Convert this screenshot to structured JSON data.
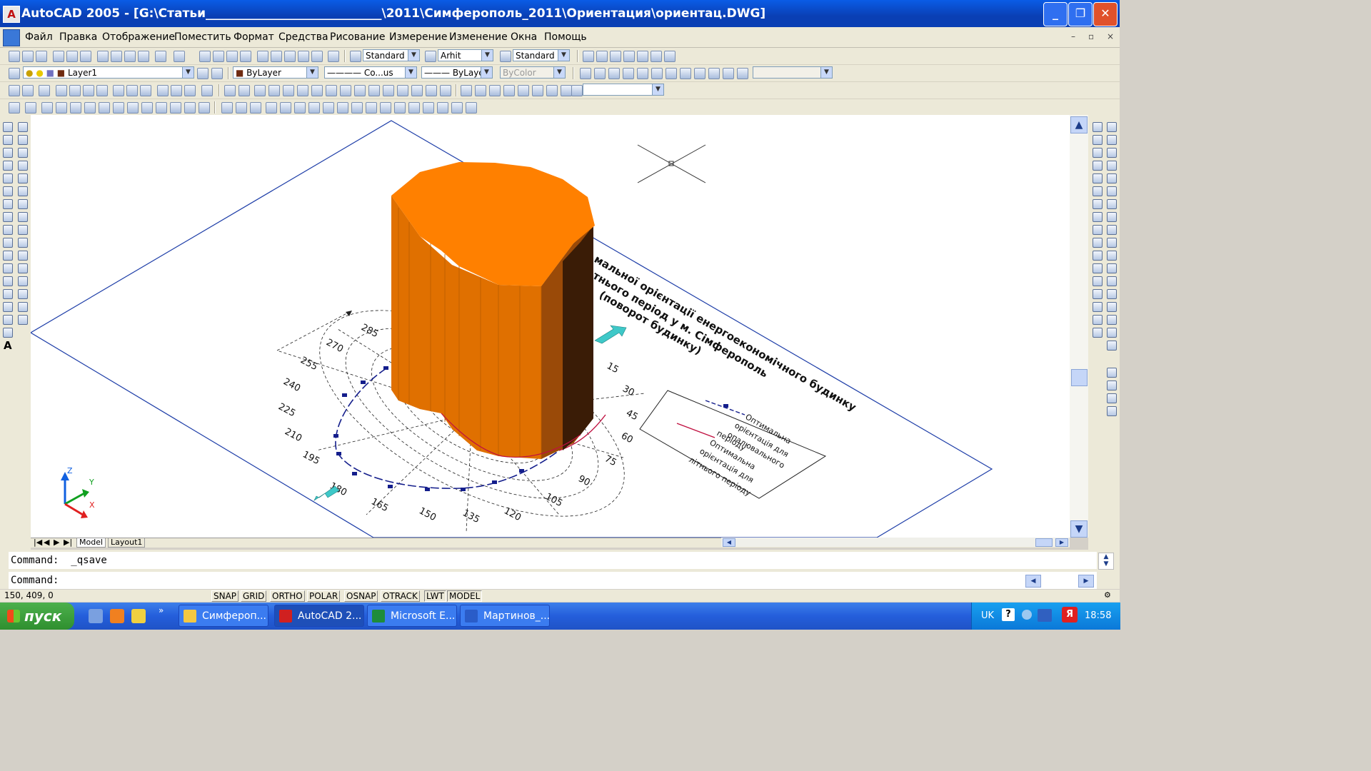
{
  "window": {
    "app_icon": "autocad-app-icon",
    "title": "AutoCAD 2005 - [G:\\Статьи_____________________________\\2011\\Симферополь_2011\\Ориентация\\ориентац.DWG]",
    "minimize_glyph": "_",
    "restore_glyph": "❐",
    "close_glyph": "✕"
  },
  "menu": [
    "Файл",
    "Правка",
    "Отображение",
    "Поместить",
    "Формат",
    "Средства",
    "Рисование",
    "Измерение",
    "Изменение",
    "Окна",
    "Помощь"
  ],
  "mdi_controls": [
    "–",
    "▫",
    "×"
  ],
  "styles_toolbar": {
    "text_style": "Standard",
    "dim_style": "Arhit",
    "table_style": "Standard"
  },
  "layers_toolbar": {
    "layer": "Layer1",
    "color": "ByLayer",
    "linetype": "Co...us",
    "lineweight": "ByLayer",
    "plot_style": "ByColor"
  },
  "drawing": {
    "title_lines": [
      "мальної орієнтації енергоекономічного будинку",
      "тнього період у м. Сімферополь",
      "(поворот будинку)"
    ],
    "compass_labels": [
      "285",
      "270",
      "255",
      "240",
      "225",
      "210",
      "195",
      "180",
      "165",
      "150",
      "135",
      "120",
      "105",
      "90",
      "75",
      "60",
      "45",
      "30",
      "15"
    ],
    "legend": [
      [
        "Оптимальна",
        "орієнтація для",
        "опалювального",
        "періоду"
      ],
      [
        "Оптимальна",
        "орієнтація для",
        "літнього періоду"
      ]
    ],
    "ucs": {
      "x": "X",
      "y": "Y",
      "z": "Z"
    },
    "colors": {
      "solid_top": "#ff8000",
      "solid_side": "#e07000",
      "solid_dark": "#3a1c06",
      "border": "#1e3ea8",
      "heating_curve": "#141e8c",
      "summer_curve": "#c01040",
      "arrows": "#3ec8c8"
    }
  },
  "layout_tabs": {
    "nav_glyphs": [
      "|◀",
      "◀",
      "▶",
      "▶|"
    ],
    "model": "Model",
    "layout": "Layout1"
  },
  "command": {
    "history": "Command:  _qsave",
    "prompt": "Command:"
  },
  "status": {
    "coords": "150, 409, 0",
    "buttons": [
      "SNAP",
      "GRID",
      "ORTHO",
      "POLAR",
      "OSNAP",
      "OTRACK",
      "LWT",
      "MODEL"
    ],
    "active": [
      "LWT",
      "MODEL"
    ]
  },
  "taskbar": {
    "start": "пуск",
    "overflow": "»",
    "tasks": [
      {
        "label": "Симфероп...",
        "icon": "folder-icon",
        "color": "#f4c842"
      },
      {
        "label": "AutoCAD 2...",
        "icon": "autocad-icon",
        "color": "#d02020"
      },
      {
        "label": "Microsoft E...",
        "icon": "excel-icon",
        "color": "#1e8c3a"
      },
      {
        "label": "Мартинов_...",
        "icon": "word-icon",
        "color": "#2a5cc8"
      }
    ],
    "active_task": "AutoCAD 2...",
    "tray": {
      "lang": "UK",
      "help": "?",
      "time": "18:58"
    }
  }
}
